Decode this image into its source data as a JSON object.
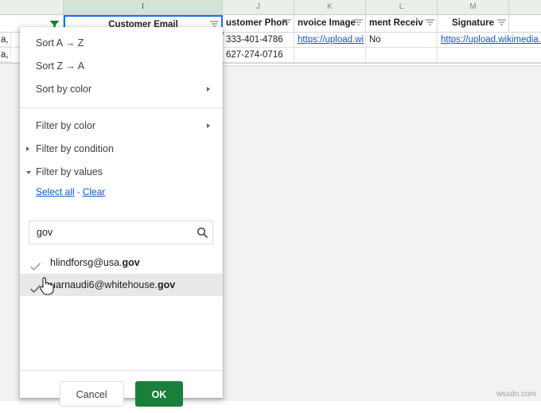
{
  "spreadsheet": {
    "column_letters": [
      "I",
      "J",
      "K",
      "L",
      "M"
    ],
    "selected_column": "I",
    "headers": [
      {
        "label": "Customer Email",
        "column": "I"
      },
      {
        "label": "ustomer Phon",
        "column": "J"
      },
      {
        "label": "nvoice Image",
        "column": "K"
      },
      {
        "label": "ment Receiv",
        "column": "L"
      },
      {
        "label": "Signature",
        "column": "M"
      }
    ],
    "rows": [
      {
        "left_fragment": "a,",
        "phone": "333-401-4786",
        "invoice_image": "https://upload.wi",
        "payment_received": "No",
        "signature": "https://upload.wikimedia."
      },
      {
        "left_fragment": "a,",
        "phone": "627-274-0716",
        "invoice_image": "",
        "payment_received": "",
        "signature": ""
      }
    ]
  },
  "filter_menu": {
    "sort_items": [
      {
        "label": "Sort A → Z",
        "submenu": false
      },
      {
        "label": "Sort Z → A",
        "submenu": false
      },
      {
        "label": "Sort by color",
        "submenu": true
      }
    ],
    "filter_items": [
      {
        "label": "Filter by color",
        "submenu": true
      }
    ],
    "condition_label": "Filter by condition",
    "condition_expanded": false,
    "values_label": "Filter by values",
    "values_expanded": true,
    "select_all_label": "Select all",
    "links_separator": "-",
    "clear_label": "Clear",
    "search": {
      "value": "gov",
      "placeholder": ""
    },
    "values": [
      {
        "text_prefix": "hlindforsg@usa.",
        "text_match": "gov",
        "checked": true,
        "hovered": false
      },
      {
        "text_prefix": "uarnaudi6@whitehouse.",
        "text_match": "gov",
        "checked": true,
        "hovered": true
      }
    ],
    "cancel_label": "Cancel",
    "ok_label": "OK"
  },
  "colors": {
    "ok_green": "#188038",
    "funnel_green": "#188038",
    "link_blue": "#1155cc",
    "selection_blue": "#1a73e8",
    "header_green": "#e8f0e9"
  },
  "watermark": "wsxdn.com"
}
